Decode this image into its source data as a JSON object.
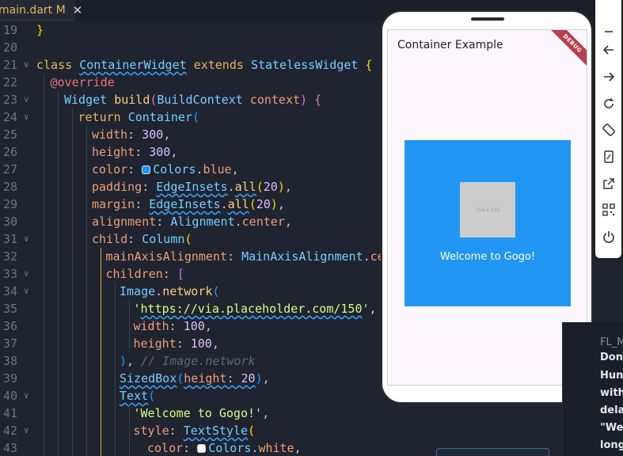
{
  "tab": {
    "label": "main.dart M",
    "close": "✕"
  },
  "editor": {
    "lines": [
      {
        "n": "19",
        "segs": [
          [
            "}",
            "br1"
          ]
        ]
      },
      {
        "n": "20",
        "segs": []
      },
      {
        "n": "21",
        "segs": [
          [
            "class ",
            "k"
          ],
          [
            "ContainerWidget",
            "t sq"
          ],
          [
            " extends ",
            "k"
          ],
          [
            "StatelessWidget",
            "t"
          ],
          [
            " {",
            "br1"
          ]
        ]
      },
      {
        "n": "22",
        "segs": [
          [
            "@override",
            "a"
          ]
        ]
      },
      {
        "n": "23",
        "segs": [
          [
            "Widget",
            "t"
          ],
          [
            " build",
            "f"
          ],
          [
            "(",
            "br2"
          ],
          [
            "BuildContext",
            "t"
          ],
          [
            " context",
            "p"
          ],
          [
            ")",
            "br2"
          ],
          [
            " {",
            "br2"
          ]
        ]
      },
      {
        "n": "24",
        "segs": [
          [
            "return ",
            "k"
          ],
          [
            "Container",
            "t"
          ],
          [
            "(",
            "br3"
          ]
        ]
      },
      {
        "n": "25",
        "segs": [
          [
            "width",
            "p"
          ],
          [
            ": ",
            "d"
          ],
          [
            "300",
            "n"
          ],
          [
            ",",
            "d"
          ]
        ]
      },
      {
        "n": "26",
        "segs": [
          [
            "height",
            "p"
          ],
          [
            ": ",
            "d"
          ],
          [
            "300",
            "n"
          ],
          [
            ",",
            "d"
          ]
        ]
      },
      {
        "n": "27",
        "segs": [
          [
            "color",
            "p"
          ],
          [
            ": ",
            "d"
          ],
          [
            "SW",
            "sw"
          ],
          [
            "Colors",
            "t"
          ],
          [
            ".",
            "d"
          ],
          [
            "blue",
            "p"
          ],
          [
            ",",
            "d"
          ]
        ]
      },
      {
        "n": "28",
        "segs": [
          [
            "padding",
            "p"
          ],
          [
            ": ",
            "d"
          ],
          [
            "EdgeInsets",
            "t sq"
          ],
          [
            ".",
            "d"
          ],
          [
            "all",
            "f sq"
          ],
          [
            "(",
            "br1"
          ],
          [
            "20",
            "n"
          ],
          [
            ")",
            "br1"
          ],
          [
            ",",
            "d"
          ]
        ]
      },
      {
        "n": "29",
        "segs": [
          [
            "margin",
            "p"
          ],
          [
            ": ",
            "d"
          ],
          [
            "EdgeInsets",
            "t sq"
          ],
          [
            ".",
            "d"
          ],
          [
            "all",
            "f sq"
          ],
          [
            "(",
            "br1"
          ],
          [
            "20",
            "n"
          ],
          [
            ")",
            "br1"
          ],
          [
            ",",
            "d"
          ]
        ]
      },
      {
        "n": "30",
        "segs": [
          [
            "alignment",
            "p"
          ],
          [
            ": ",
            "d"
          ],
          [
            "Alignment",
            "t"
          ],
          [
            ".",
            "d"
          ],
          [
            "center",
            "p"
          ],
          [
            ",",
            "d"
          ]
        ]
      },
      {
        "n": "31",
        "segs": [
          [
            "child",
            "p"
          ],
          [
            ": ",
            "d"
          ],
          [
            "Column",
            "t"
          ],
          [
            "(",
            "br1"
          ]
        ]
      },
      {
        "n": "32",
        "segs": [
          [
            "mainAxisAlignment",
            "p"
          ],
          [
            ": ",
            "d"
          ],
          [
            "MainAxisAlignment",
            "t"
          ],
          [
            ".",
            "d"
          ],
          [
            "cente",
            "p"
          ]
        ]
      },
      {
        "n": "33",
        "segs": [
          [
            "children",
            "p"
          ],
          [
            ": ",
            "d"
          ],
          [
            "[",
            "br2"
          ]
        ]
      },
      {
        "n": "34",
        "segs": [
          [
            "Image",
            "t"
          ],
          [
            ".",
            "d"
          ],
          [
            "network",
            "f"
          ],
          [
            "(",
            "br3"
          ]
        ]
      },
      {
        "n": "35",
        "segs": [
          [
            "'",
            "s"
          ],
          [
            "https://via.placeholder.com/150",
            "s sq"
          ],
          [
            "'",
            "s"
          ],
          [
            ",",
            "d"
          ]
        ]
      },
      {
        "n": "36",
        "segs": [
          [
            "width",
            "p"
          ],
          [
            ": ",
            "d"
          ],
          [
            "100",
            "n"
          ],
          [
            ",",
            "d"
          ]
        ]
      },
      {
        "n": "37",
        "segs": [
          [
            "height",
            "p"
          ],
          [
            ": ",
            "d"
          ],
          [
            "100",
            "n"
          ],
          [
            ",",
            "d"
          ]
        ]
      },
      {
        "n": "38",
        "segs": [
          [
            ")",
            "br3"
          ],
          [
            ", ",
            "d"
          ],
          [
            "// Image.network",
            "c"
          ]
        ]
      },
      {
        "n": "39",
        "segs": [
          [
            "SizedBox",
            "t sq"
          ],
          [
            "(",
            "br3"
          ],
          [
            "height",
            "p sq"
          ],
          [
            ": ",
            "d sq"
          ],
          [
            "20",
            "n sq"
          ],
          [
            ")",
            "br3"
          ],
          [
            ",",
            "d"
          ]
        ]
      },
      {
        "n": "40",
        "segs": [
          [
            "Text",
            "t sq"
          ],
          [
            "(",
            "br3"
          ]
        ]
      },
      {
        "n": "41",
        "segs": [
          [
            "'Welcome to Gogo!'",
            "s"
          ],
          [
            ",",
            "d"
          ]
        ]
      },
      {
        "n": "42",
        "segs": [
          [
            "style",
            "p"
          ],
          [
            ": ",
            "d"
          ],
          [
            "TextStyle",
            "t sq"
          ],
          [
            "(",
            "br1"
          ]
        ]
      },
      {
        "n": "43",
        "segs": [
          [
            "color",
            "p"
          ],
          [
            ": ",
            "d"
          ],
          [
            "SW2",
            "sw"
          ],
          [
            "Colors",
            "t"
          ],
          [
            ".",
            "d"
          ],
          [
            "white",
            "p"
          ],
          [
            ",",
            "d"
          ]
        ]
      }
    ],
    "swatch_blue": "#2196f3",
    "swatch_white": "#ffffff"
  },
  "emulator": {
    "app_title": "Container Example",
    "debug_banner": "DEBUG",
    "placeholder_text": "150 x 150",
    "welcome_text": "Welcome to Gogo!",
    "container_color": "#2196f3"
  },
  "toolbar": {
    "items": [
      "minimize-icon",
      "back-icon",
      "forward-icon",
      "rotate-icon",
      "rotate-device-icon",
      "resize-icon",
      "open-external-icon",
      "qr-code-icon",
      "power-icon"
    ]
  },
  "right_panel": {
    "heading": "FL_M",
    "lines": [
      "Don't",
      "Hund",
      "with",
      "delay",
      "\"Web",
      "longe"
    ]
  }
}
